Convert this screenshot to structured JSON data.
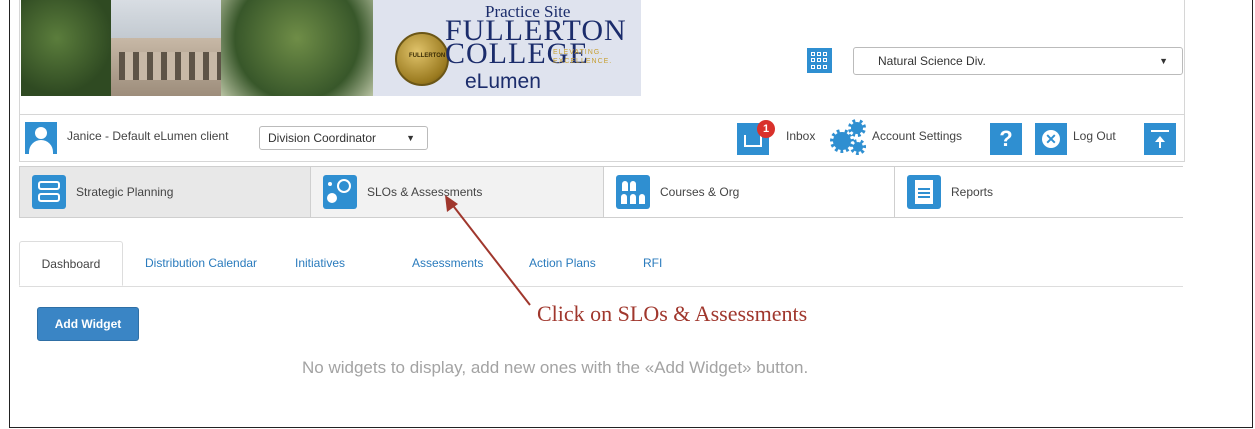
{
  "banner": {
    "practice_label": "Practice Site",
    "college_line1": "FULLERTON",
    "college_line2": "COLLEGE",
    "tagline1": "ELEVATING.",
    "tagline2": "EXCELLENCE.",
    "product": "eLumen",
    "seal_text": "FULLERTON",
    "division_select": "Natural Science Div."
  },
  "userbar": {
    "user_name": "Janice - Default eLumen client",
    "role_select": "Division Coordinator",
    "inbox_badge": "1",
    "inbox_label": "Inbox",
    "account_label": "Account Settings",
    "help_glyph": "?",
    "logout_glyph": "✕",
    "logout_label": "Log Out"
  },
  "modules": [
    {
      "label": "Strategic Planning",
      "icon": "strategic-planning-icon"
    },
    {
      "label": "SLOs & Assessments",
      "icon": "slo-assessments-icon"
    },
    {
      "label": "Courses & Org",
      "icon": "courses-org-icon"
    },
    {
      "label": "Reports",
      "icon": "reports-icon"
    }
  ],
  "tabs": [
    "Dashboard",
    "Distribution Calendar",
    "Initiatives",
    "Assessments",
    "Action Plans",
    "RFI"
  ],
  "dashboard": {
    "add_widget": "Add Widget",
    "empty_message": "No widgets to display, add new ones with the «Add Widget» button."
  },
  "annotation": {
    "text": "Click on SLOs & Assessments",
    "color": "#a0372d"
  },
  "colors": {
    "accent": "#2f8fd1",
    "button": "#3a85c5",
    "badge": "#d9312b"
  }
}
